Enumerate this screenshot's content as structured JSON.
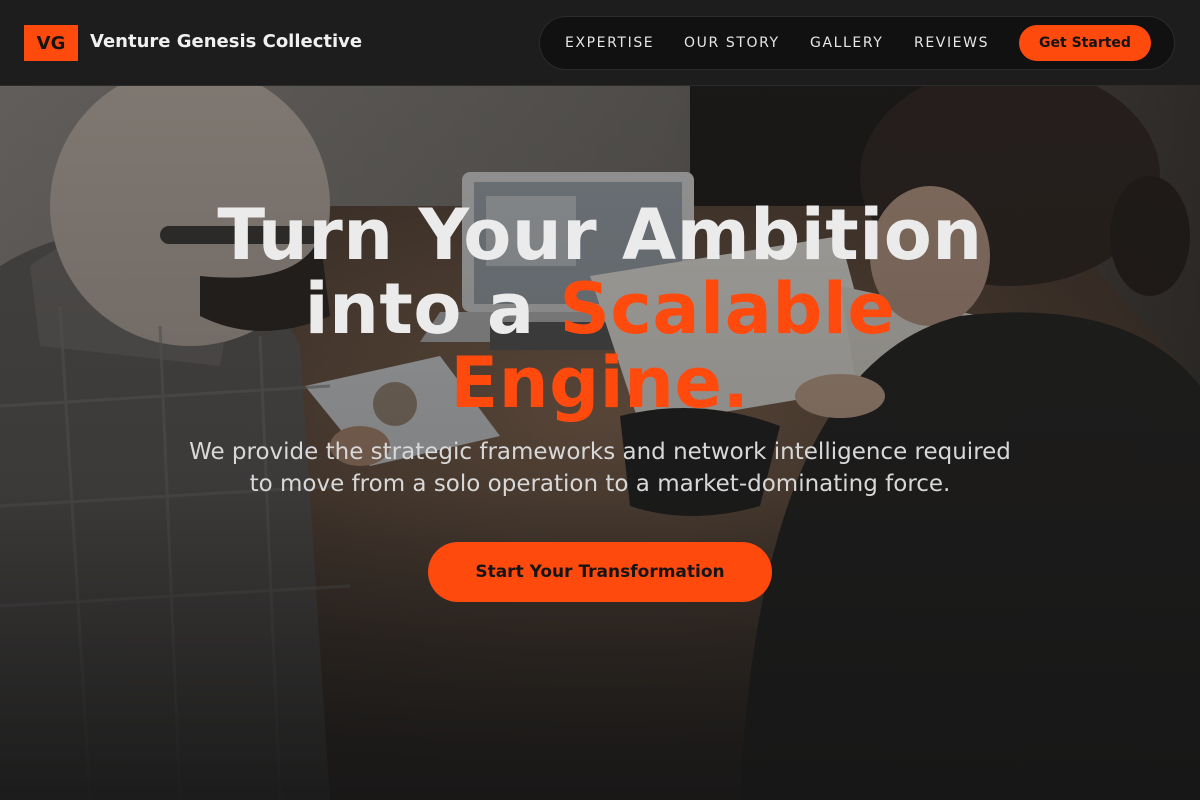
{
  "brand": {
    "mark": "VG",
    "name": "Venture Genesis Collective",
    "accent_color": "#ff4a0e"
  },
  "nav": {
    "links": [
      "EXPERTISE",
      "OUR STORY",
      "GALLERY",
      "REVIEWS"
    ],
    "cta_label": "Get Started"
  },
  "hero": {
    "title_line1": "Turn Your Ambition",
    "title_line2_prefix": "into a ",
    "title_accent": "Scalable",
    "title_accent_line3": "Engine.",
    "subtitle_line1": "We provide the strategic frameworks and network intelligence required",
    "subtitle_line2": "to move from a solo operation to a market-dominating force.",
    "cta_label": "Start Your Transformation",
    "background_image": "business-meeting-photo"
  }
}
